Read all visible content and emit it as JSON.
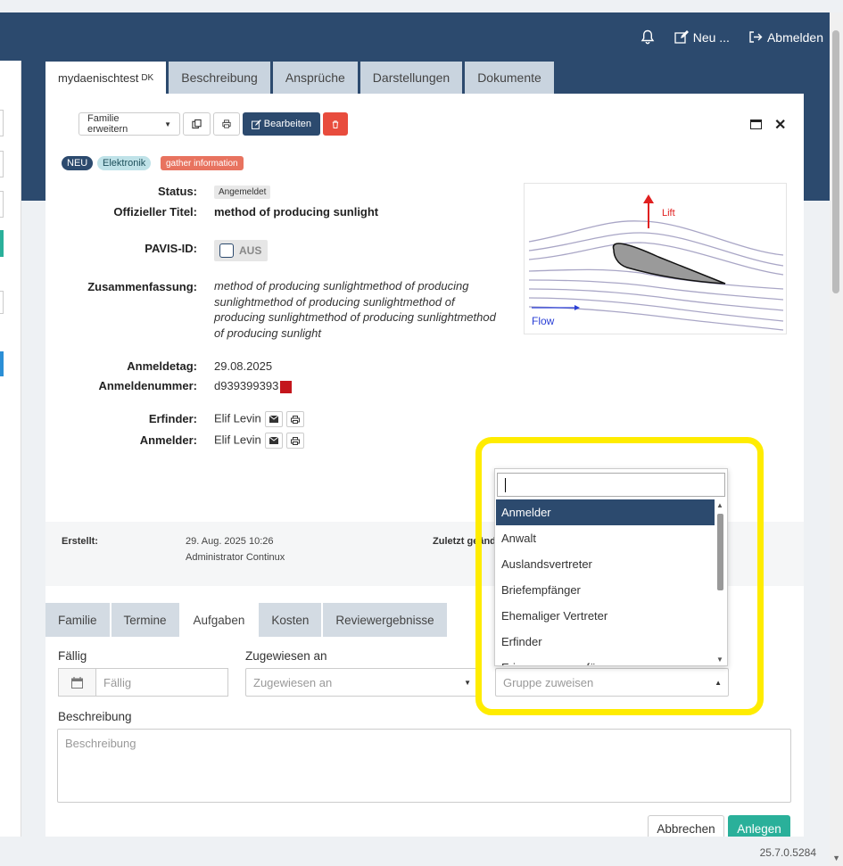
{
  "topnav": {
    "neu": "Neu ...",
    "abmelden": "Abmelden"
  },
  "tabs": [
    {
      "label": "mydaenischtest",
      "suffix": "DK"
    },
    {
      "label": "Beschreibung"
    },
    {
      "label": "Ansprüche"
    },
    {
      "label": "Darstellungen"
    },
    {
      "label": "Dokumente"
    }
  ],
  "toolbar": {
    "family_label": "Familie erweitern",
    "edit_label": "Bearbeiten"
  },
  "badges": [
    "NEU",
    "Elektronik",
    "gather information"
  ],
  "fields": {
    "status_label": "Status:",
    "status_value": "Angemeldet",
    "title_label": "Offizieller Titel:",
    "title_value": "method of producing sunlight",
    "pavis_label": "PAVIS-ID:",
    "pavis_value": "AUS",
    "summary_label": "Zusammenfassung:",
    "summary_value": "method of producing sunlightmethod of producing sunlightmethod of producing sunlightmethod of producing sunlightmethod of producing sunlightmethod of producing sunlight",
    "date_label": "Anmeldetag:",
    "date_value": "29.08.2025",
    "number_label": "Anmeldenummer:",
    "number_value": "d939399393",
    "inventor_label": "Erfinder:",
    "inventor_value": "Elif Levin",
    "applicant_label": "Anmelder:",
    "applicant_value": "Elif Levin"
  },
  "figure": {
    "lift": "Lift",
    "flow": "Flow"
  },
  "meta": {
    "created_label": "Erstellt:",
    "created_date": "29. Aug. 2025 10:26",
    "created_by": "Administrator Continux",
    "modified_label": "Zuletzt geänd"
  },
  "subtabs": [
    "Familie",
    "Termine",
    "Aufgaben",
    "Kosten",
    "Reviewergebnisse"
  ],
  "form": {
    "due_label": "Fällig",
    "due_placeholder": "Fällig",
    "assigned_label": "Zugewiesen an",
    "assigned_placeholder": "Zugewiesen an",
    "group_placeholder": "Gruppe zuweisen",
    "desc_label": "Beschreibung",
    "desc_placeholder": "Beschreibung",
    "cancel": "Abbrechen",
    "create": "Anlegen"
  },
  "dropdown": {
    "items": [
      "Anmelder",
      "Anwalt",
      "Auslandsvertreter",
      "Briefempfänger",
      "Ehemaliger Vertreter",
      "Erfinder",
      "Erinnerungsempfänger"
    ]
  },
  "version": "25.7.0.5284",
  "colors": {
    "primary": "#2c4a6e",
    "accent": "#2ab09a",
    "danger": "#e84c3d",
    "highlight": "#ffec00"
  }
}
